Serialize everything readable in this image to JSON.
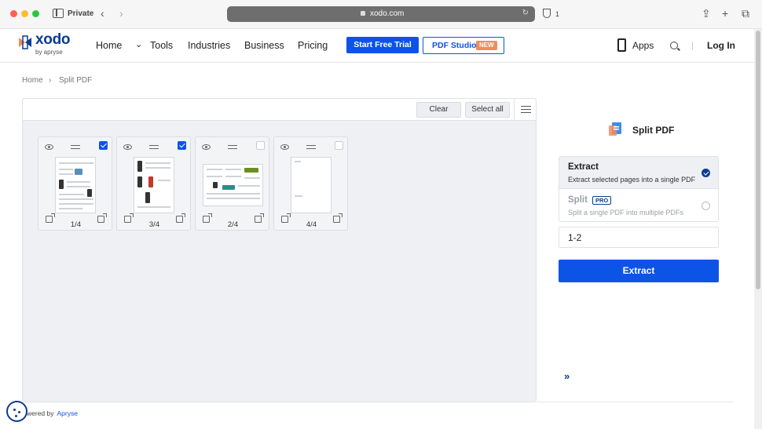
{
  "browser": {
    "private_label": "Private",
    "url": "xodo.com",
    "tab_count": "1"
  },
  "header": {
    "logo_text": "xodo",
    "logo_sub": "by apryse",
    "nav": [
      "Home",
      "Tools",
      "Industries",
      "Business",
      "Pricing"
    ],
    "trial_label": "Start Free Trial",
    "studio_label": "PDF Studio",
    "studio_badge": "NEW",
    "apps_label": "Apps",
    "login_label": "Log In"
  },
  "breadcrumb": [
    "Home",
    "Split PDF"
  ],
  "toolbar": {
    "clear_label": "Clear",
    "select_all_label": "Select all"
  },
  "pages": [
    {
      "label": "1/4",
      "checked": true
    },
    {
      "label": "3/4",
      "checked": true
    },
    {
      "label": "2/4",
      "checked": false
    },
    {
      "label": "4/4",
      "checked": false
    }
  ],
  "tool": {
    "title": "Split PDF",
    "options": [
      {
        "title": "Extract",
        "desc": "Extract selected pages into a single PDF",
        "selected": true
      },
      {
        "title": "Split",
        "badge": "PRO",
        "desc": "Split a single PDF into multiple PDFs",
        "selected": false
      }
    ],
    "range_value": "1-2",
    "action_label": "Extract"
  },
  "footer": {
    "powered_by": "wered by",
    "powered_link": "Apryse"
  },
  "colors": {
    "accent": "#0c54e6",
    "brand": "#0a3d91"
  }
}
